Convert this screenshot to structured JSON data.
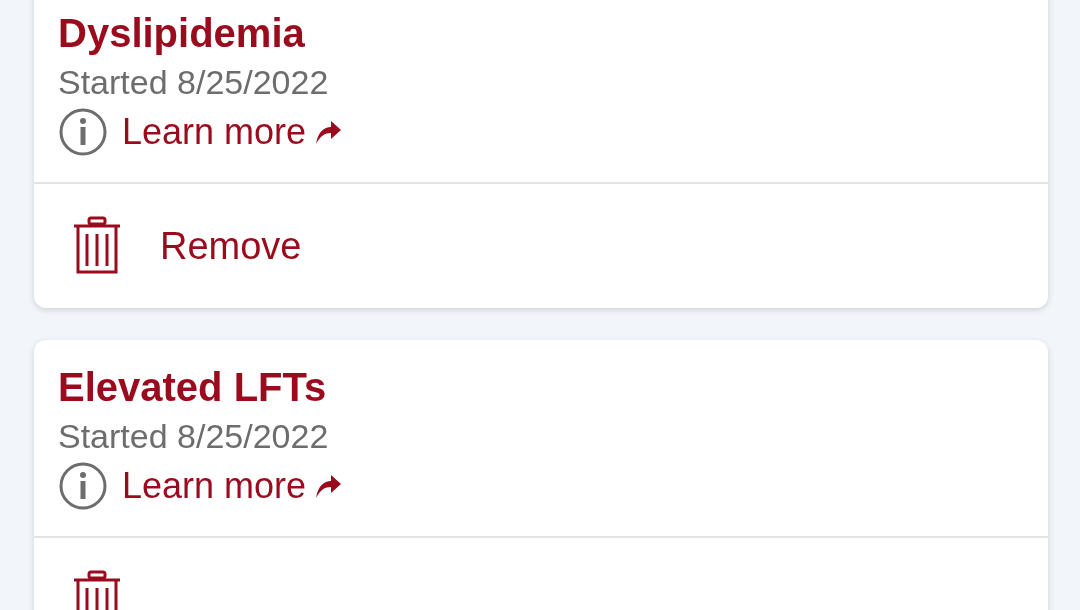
{
  "conditions": [
    {
      "name": "Dyslipidemia",
      "started": "Started 8/25/2022",
      "link": "Learn more",
      "action": "Remove"
    },
    {
      "name": "Elevated LFTs",
      "started": "Started 8/25/2022",
      "link": "Learn more"
    }
  ]
}
